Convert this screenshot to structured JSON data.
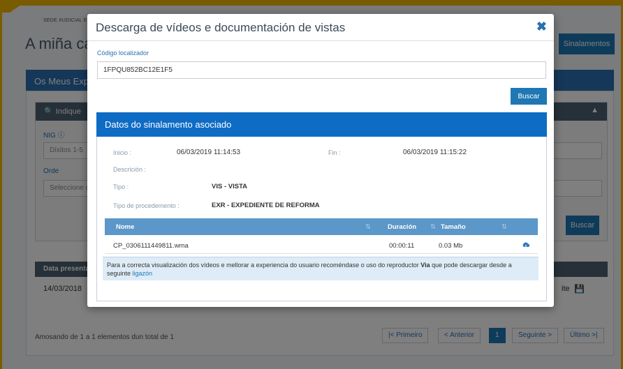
{
  "background": {
    "site_label": "SEDE XUDICIAL EL",
    "page_title": "A miña ca",
    "sinalamentos_button": "Sinalamentos",
    "panel_title": "Os Meus Exp",
    "filter_title": "Indique",
    "nig_label": "NIG",
    "nig_placeholder": "Díxitos 1-5",
    "orde_label": "Orde",
    "orde_placeholder": "Seleccione u",
    "buscar_button": "Buscar",
    "table_header": "Data presenta",
    "row_date": "14/03/2018",
    "row_right_text": "ite",
    "summary": "Amosando de 1 a 1 elementos dun total de 1",
    "pager": [
      "|< Primeiro",
      "< Anterior",
      "1",
      "Seguinte >",
      "Último >|"
    ]
  },
  "modal": {
    "title": "Descarga de vídeos e documentación de vistas",
    "code_label": "Código localizador",
    "code_value": "1FPQU852BC12E1F5",
    "buscar_button": "Buscar",
    "section_title": "Datos do sinalamento asociado",
    "details": {
      "inicio_label": "Inicio :",
      "inicio_value": "06/03/2019 11:14:53",
      "fin_label": "Fin :",
      "fin_value": "06/03/2019 11:15:22",
      "descricion_label": "Descrición :",
      "tipo_label": "Tipo :",
      "tipo_value": "VIS - VISTA",
      "tipo_proc_label": "Tipo de procedemento :",
      "tipo_proc_value": "EXR - EXPEDIENTE DE REFORMA"
    },
    "files_table": {
      "headers": [
        "Nome",
        "Duración",
        "Tamaño"
      ],
      "rows": [
        {
          "name": "CP_0306111449811.wma",
          "duration": "00:00:11",
          "size": "0.03 Mb"
        }
      ]
    },
    "info_text_before": "Para a correcta visualización dos vídeos e mellorar a experiencia do usuario recoméndase o uso do reproductor ",
    "info_bold": "Via",
    "info_text_after": " que pode descargar desde a seguinte ",
    "info_link": "ligazón",
    "close_icon": "close-icon"
  }
}
